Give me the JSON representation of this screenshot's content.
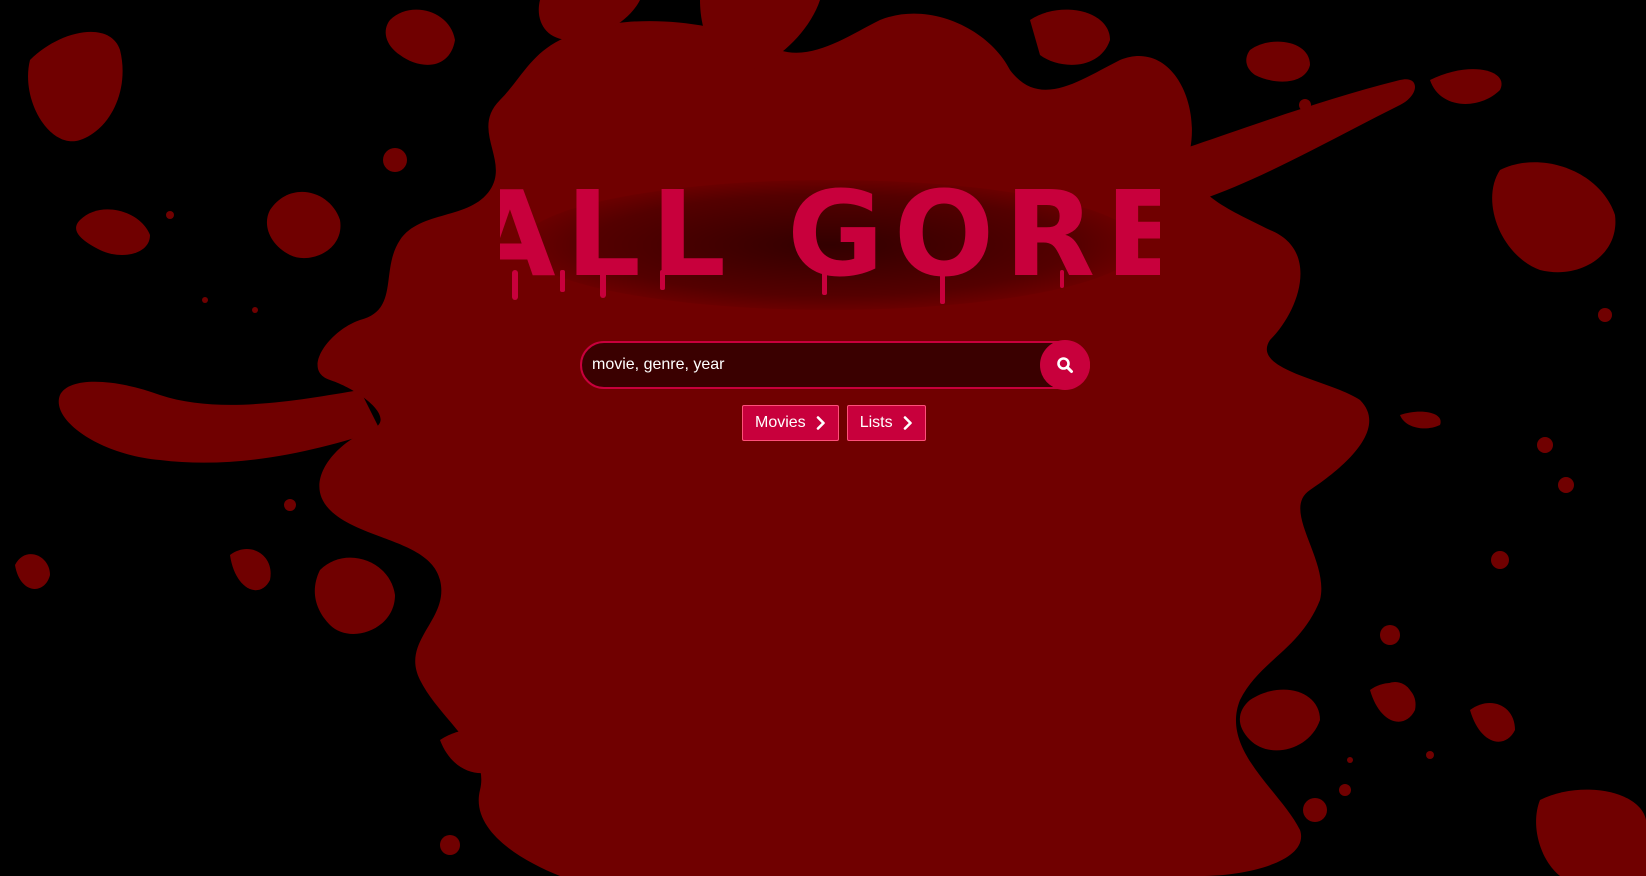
{
  "app": {
    "logo_text": "ALL GORE"
  },
  "search": {
    "placeholder": "movie, genre, year",
    "button_icon": "search-icon"
  },
  "nav": {
    "buttons": [
      {
        "label": "Movies",
        "icon": "chevron-right-icon"
      },
      {
        "label": "Lists",
        "icon": "chevron-right-icon"
      }
    ]
  },
  "colors": {
    "background": "#000000",
    "blood": "#700000",
    "accent": "#c8003c",
    "search_bg": "#3a0000",
    "text": "#ffffff"
  }
}
